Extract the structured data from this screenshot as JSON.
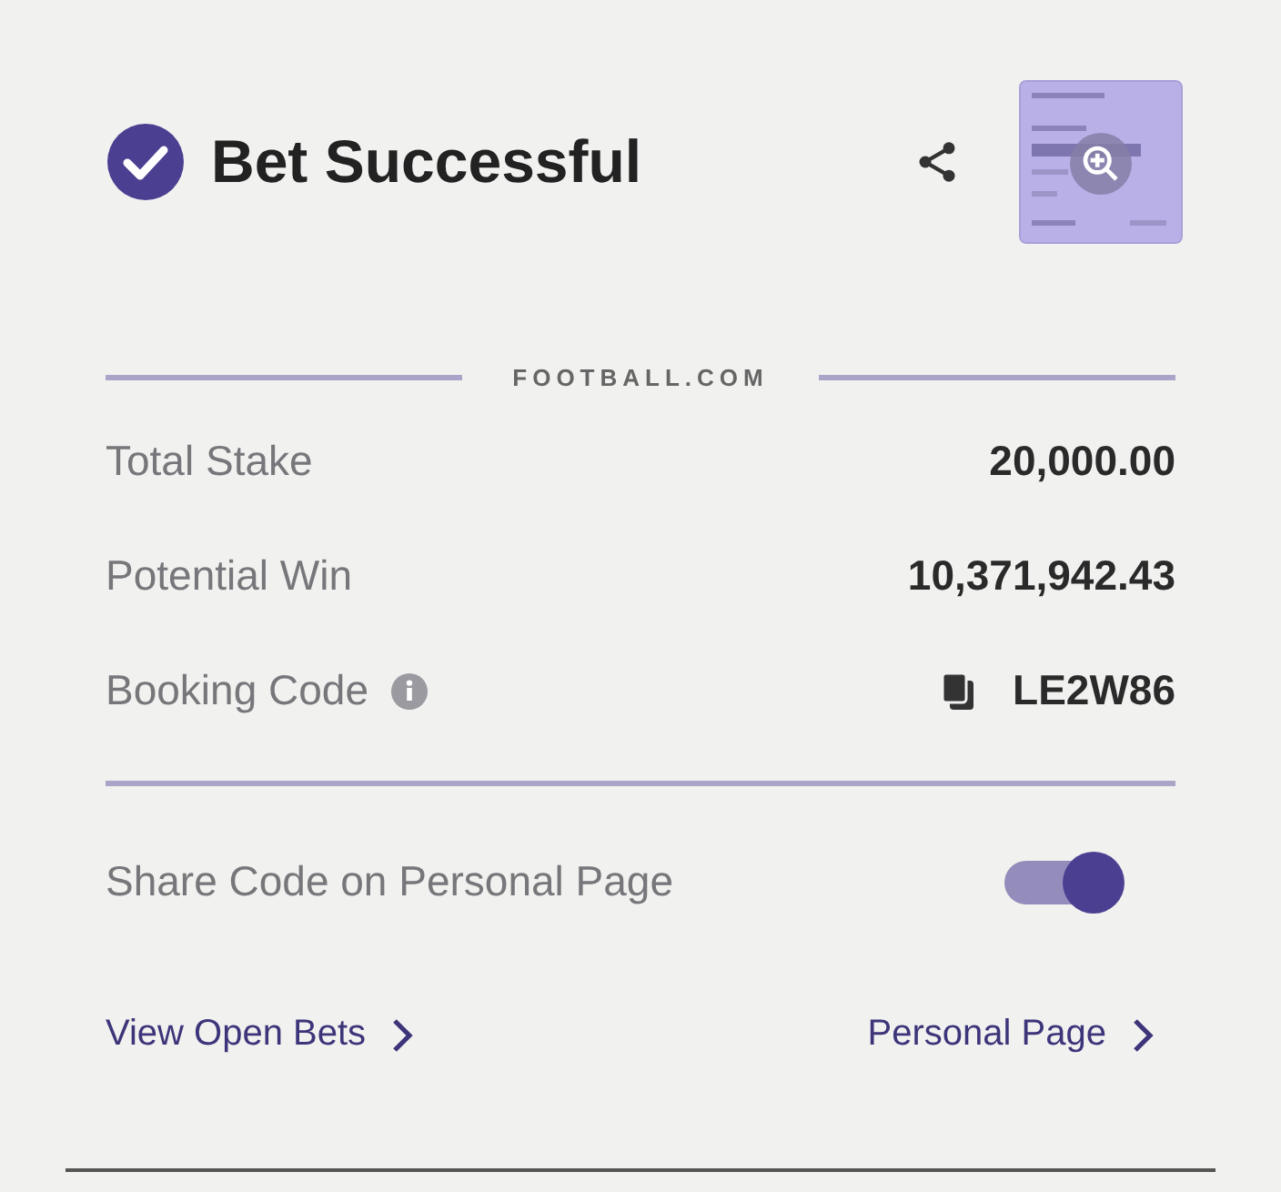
{
  "header": {
    "title": "Bet Successful"
  },
  "brand": "FOOTBALL.COM",
  "rows": [
    {
      "label": "Total Stake",
      "value": "20,000.00",
      "kind": "plain"
    },
    {
      "label": "Potential Win",
      "value": "10,371,942.43",
      "kind": "plain"
    },
    {
      "label": "Booking Code",
      "value": "LE2W86",
      "kind": "code"
    }
  ],
  "share_toggle": {
    "label": "Share Code on Personal Page",
    "on": true
  },
  "links": [
    "View Open Bets",
    "Personal Page"
  ]
}
